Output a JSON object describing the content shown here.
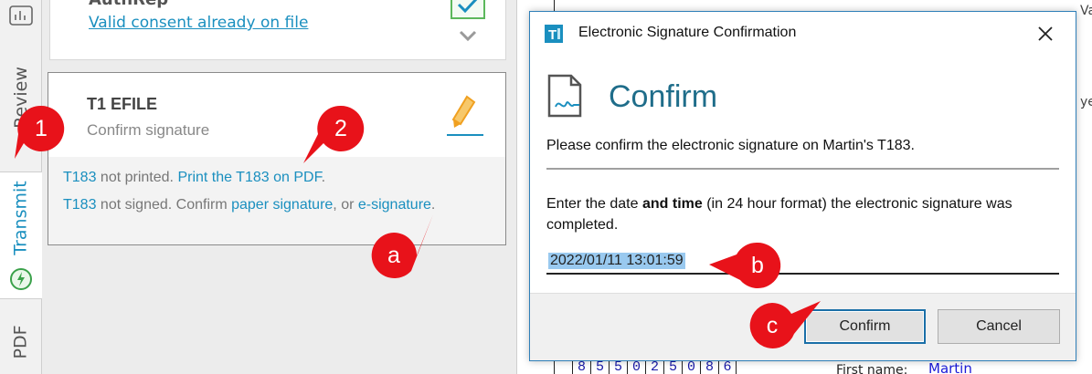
{
  "left_tabs": {
    "review": "Review",
    "transmit": "Transmit",
    "pdf": "PDF"
  },
  "authrep_card": {
    "title": "AuthRep",
    "link_text": "Valid consent already on file"
  },
  "efile_card": {
    "title": "T1 EFILE",
    "subtitle": "Confirm signature",
    "line1": {
      "form": "T183",
      "status": "not printed.",
      "action": "Print the T183 on PDF",
      "end": "."
    },
    "line2": {
      "form": "T183",
      "status": "not signed. Confirm",
      "paper_link": "paper signature",
      "or": ", or",
      "esig_link": "e-signature",
      "end": "."
    }
  },
  "dialog": {
    "title": "Electronic Signature Confirmation",
    "heading": "Confirm",
    "message": "Please confirm the electronic signature on Martin's T183.",
    "instruction_pre": "Enter the date ",
    "instruction_bold": "and time",
    "instruction_post": " (in 24 hour format) the electronic signature was completed.",
    "datetime_value": "2022/01/11 13:01:59",
    "confirm_button": "Confirm",
    "cancel_button": "Cancel"
  },
  "background_doc": {
    "header_fragment": "Va",
    "side_fragment": "ye",
    "digits": [
      "8",
      "5",
      "5",
      "0",
      "2",
      "5",
      "0",
      "8",
      "6"
    ],
    "first_name_label": "First name:",
    "first_name_value": "Martin"
  },
  "callouts": {
    "one": "1",
    "two": "2",
    "a": "a",
    "b": "b",
    "c": "c"
  },
  "colors": {
    "link_blue": "#1a8fbf",
    "callout_red": "#e8121a",
    "dialog_heading": "#1f6d8a",
    "pencil_orange": "#f5a623",
    "check_green": "#5cb85c"
  }
}
